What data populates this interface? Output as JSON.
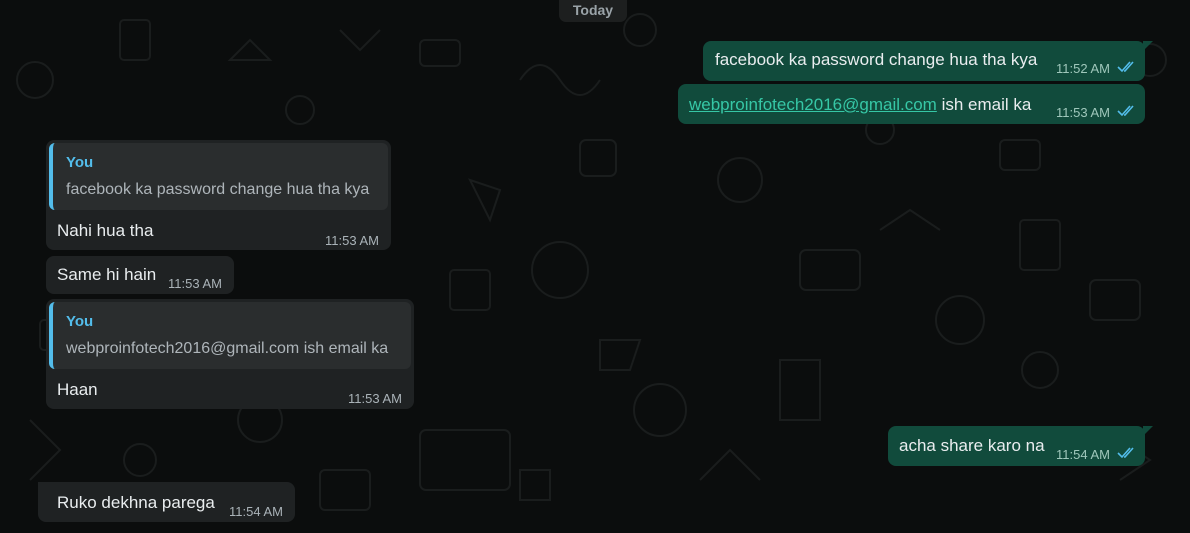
{
  "chat": {
    "date_divider": "Today",
    "messages": [
      {
        "direction": "outgoing",
        "text": "facebook ka password change hua tha kya",
        "time": "11:52 AM",
        "status": "read-double-tick-icon"
      },
      {
        "direction": "outgoing",
        "link": "webproinfotech2016@gmail.com",
        "text": "ish email ka",
        "time": "11:53 AM",
        "status": "read-double-tick-icon"
      },
      {
        "direction": "incoming",
        "quote": {
          "author": "You",
          "text": "facebook ka password change hua tha kya"
        },
        "text": "Nahi hua tha",
        "time": "11:53 AM"
      },
      {
        "direction": "incoming",
        "text": "Same hi hain",
        "time": "11:53 AM"
      },
      {
        "direction": "incoming",
        "quote": {
          "author": "You",
          "text": "webproinfotech2016@gmail.com ish email ka"
        },
        "text": "Haan",
        "time": "11:53 AM"
      },
      {
        "direction": "outgoing",
        "text": "acha share karo na",
        "time": "11:54 AM",
        "status": "read-double-tick-icon"
      },
      {
        "direction": "incoming",
        "text": "Ruko dekhna parega",
        "time": "11:54 AM"
      }
    ]
  },
  "colors": {
    "background": "#0b0d0d",
    "incoming_bubble": "#1f2223",
    "outgoing_bubble": "#114b3c",
    "quote_accent": "#53bdeb",
    "read_tick": "#53bdeb",
    "link": "#36c7a6"
  }
}
